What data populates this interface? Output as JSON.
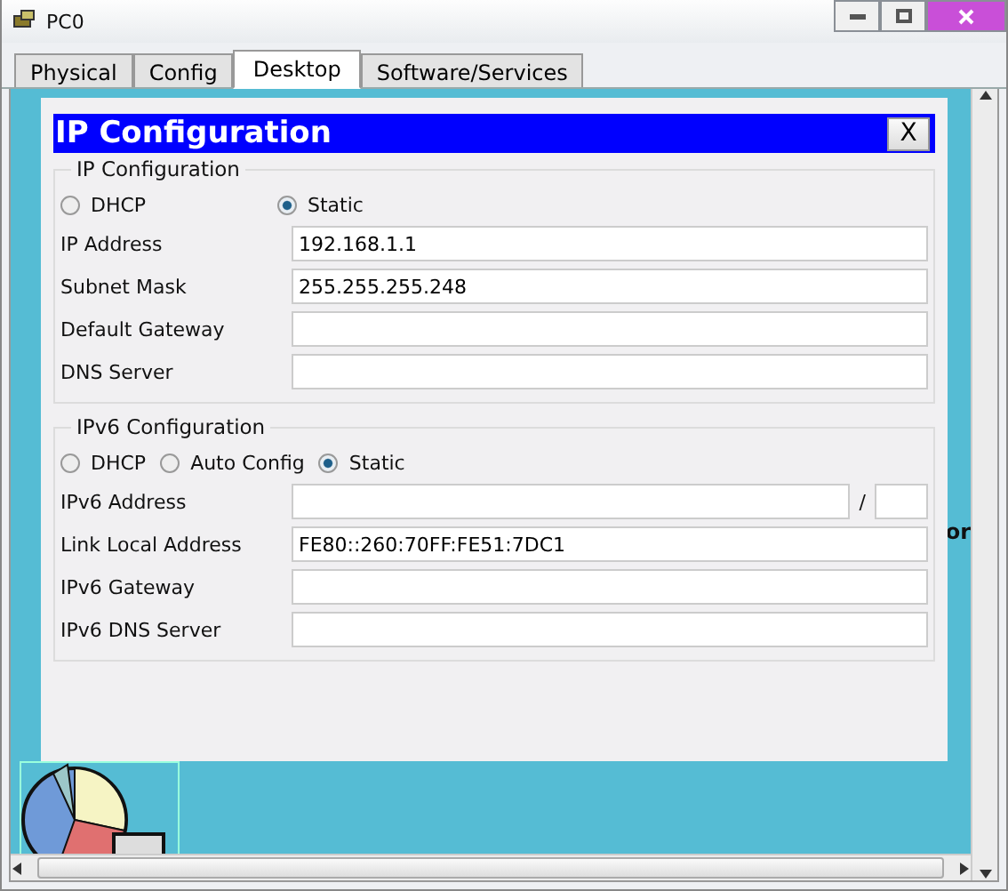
{
  "window": {
    "title": "PC0"
  },
  "tabs": [
    {
      "label": "Physical",
      "selected": false
    },
    {
      "label": "Config",
      "selected": false
    },
    {
      "label": "Desktop",
      "selected": true
    },
    {
      "label": "Software/Services",
      "selected": false
    }
  ],
  "background_text": "or",
  "dialog": {
    "title": "IP Configuration",
    "close_label": "X",
    "ipv4": {
      "legend": "IP Configuration",
      "modes": [
        {
          "label": "DHCP",
          "selected": false
        },
        {
          "label": "Static",
          "selected": true
        }
      ],
      "fields": [
        {
          "label": "IP Address",
          "value": "192.168.1.1"
        },
        {
          "label": "Subnet Mask",
          "value": "255.255.255.248"
        },
        {
          "label": "Default Gateway"
        },
        {
          "label": "DNS Server"
        }
      ]
    },
    "ipv6": {
      "legend": "IPv6 Configuration",
      "modes": [
        {
          "label": "DHCP",
          "selected": false
        },
        {
          "label": "Auto Config",
          "selected": false
        },
        {
          "label": "Static",
          "selected": true
        }
      ],
      "fields": [
        {
          "label": "IPv6 Address",
          "kind": "prefix",
          "separator": "/"
        },
        {
          "label": "Link Local Address",
          "kind": "plain",
          "value": "FE80::260:70FF:FE51:7DC1"
        },
        {
          "label": "IPv6 Gateway",
          "kind": "plain"
        },
        {
          "label": "IPv6 DNS Server",
          "kind": "plain"
        }
      ]
    }
  }
}
